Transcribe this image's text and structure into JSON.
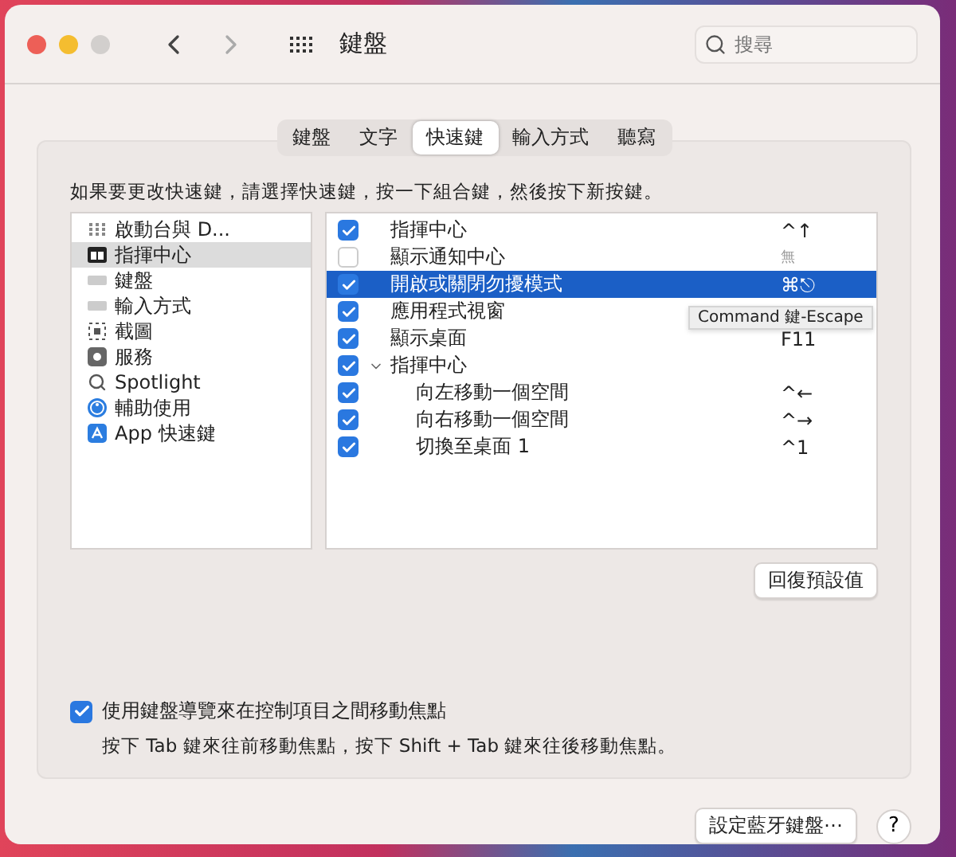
{
  "window": {
    "title": "鍵盤",
    "search": {
      "placeholder": "搜尋"
    }
  },
  "tabs": [
    {
      "label": "鍵盤",
      "selected": false
    },
    {
      "label": "文字",
      "selected": false
    },
    {
      "label": "快速鍵",
      "selected": true
    },
    {
      "label": "輸入方式",
      "selected": false
    },
    {
      "label": "聽寫",
      "selected": false
    }
  ],
  "instruction": "如果要更改快速鍵，請選擇快速鍵，按一下組合鍵，然後按下新按鍵。",
  "categories": [
    {
      "label": "啟動台與 D...",
      "selected": false
    },
    {
      "label": "指揮中心",
      "selected": true
    },
    {
      "label": "鍵盤",
      "selected": false
    },
    {
      "label": "輸入方式",
      "selected": false
    },
    {
      "label": "截圖",
      "selected": false
    },
    {
      "label": "服務",
      "selected": false
    },
    {
      "label": "Spotlight",
      "selected": false
    },
    {
      "label": "輔助使用",
      "selected": false
    },
    {
      "label": "App 快速鍵",
      "selected": false
    }
  ],
  "shortcuts": [
    {
      "label": "指揮中心",
      "shortcut": "^↑",
      "checked": true,
      "selected": false
    },
    {
      "label": "顯示通知中心",
      "shortcut": "無",
      "checked": false,
      "selected": false
    },
    {
      "label": "開啟或關閉勿擾模式",
      "shortcut": "⌘⎋",
      "checked": true,
      "selected": true
    },
    {
      "label": "應用程式視窗",
      "checked": true,
      "selected": false
    },
    {
      "label": "顯示桌面",
      "shortcut": "F11",
      "checked": true,
      "selected": false
    },
    {
      "label": "指揮中心",
      "checked": true,
      "selected": false,
      "expanded": true,
      "children": [
        {
          "label": "向左移動一個空間",
          "shortcut": "^←",
          "checked": true,
          "selected": false
        },
        {
          "label": "向右移動一個空間",
          "shortcut": "^→",
          "checked": true,
          "selected": false
        },
        {
          "label": "切換至桌面 1",
          "shortcut": "^1",
          "checked": true,
          "selected": false
        }
      ]
    }
  ],
  "tooltip": "Command 鍵-Escape",
  "restore_button": "回復預設值",
  "keyboard_navigation": {
    "label": "使用鍵盤導覽來在控制項目之間移動焦點",
    "checked": true,
    "note": "按下 Tab 鍵來往前移動焦點，按下 Shift + Tab 鍵來往後移動焦點。"
  },
  "bluetooth_button": "設定藍牙鍵盤⋯",
  "help_button": "?"
}
